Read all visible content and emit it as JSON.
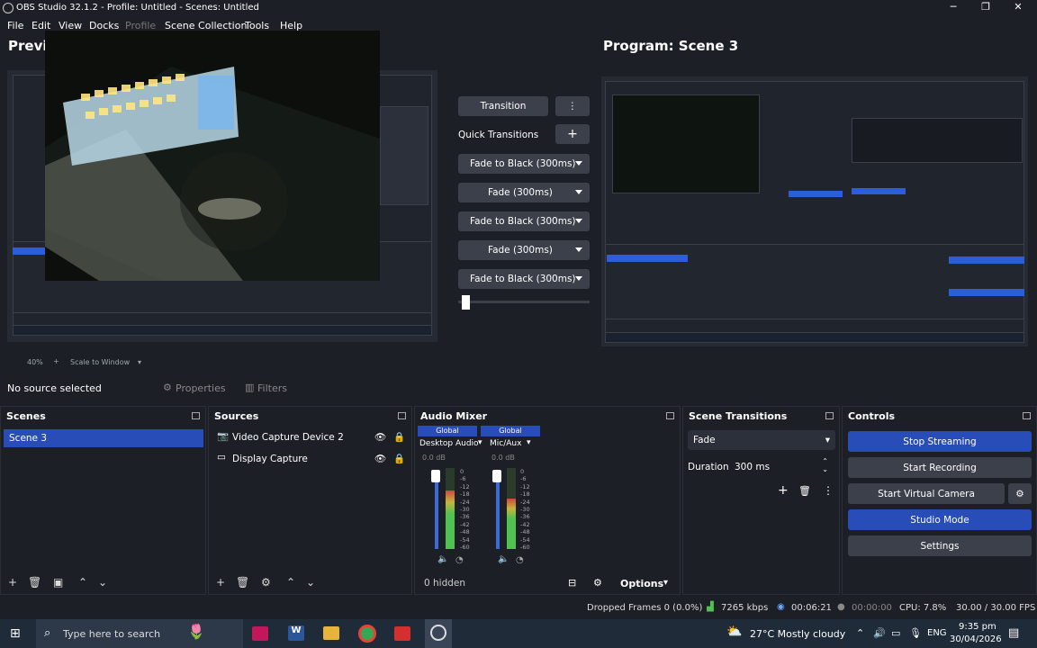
{
  "window": {
    "title": "OBS Studio 32.1.2 - Profile: Untitled - Scenes: Untitled",
    "minimize": "─",
    "maximize": "❐",
    "close": "✕"
  },
  "menu": {
    "items": [
      {
        "label": "File"
      },
      {
        "label": "Edit"
      },
      {
        "label": "View"
      },
      {
        "label": "Docks"
      },
      {
        "label": "Profile"
      },
      {
        "label": "Scene Collection"
      },
      {
        "label": "Tools"
      },
      {
        "label": "Help"
      }
    ]
  },
  "preview": {
    "label": "Previ",
    "zoom": "40%",
    "scale_mode": "Scale to Window"
  },
  "program": {
    "label": "Program: Scene 3"
  },
  "transitions": {
    "transition_label": "Transition",
    "quick_label": "Quick Transitions",
    "buttons": [
      "Fade to Black (300ms)",
      "Fade (300ms)",
      "Fade to Black (300ms)",
      "Fade (300ms)",
      "Fade to Black (300ms)"
    ],
    "tbar_value": 0.03
  },
  "source_bar": {
    "no_source": "No source selected",
    "properties": "Properties",
    "filters": "Filters"
  },
  "scenes": {
    "title": "Scenes",
    "items": [
      "Scene 3"
    ]
  },
  "sources": {
    "title": "Sources",
    "items": [
      {
        "label": "Video Capture Device 2",
        "icon": "camera-icon"
      },
      {
        "label": "Display Capture",
        "icon": "monitor-icon"
      }
    ]
  },
  "audio": {
    "title": "Audio Mixer",
    "channels": [
      {
        "tag": "Global",
        "name": "Desktop Audio",
        "db": "0.0 dB",
        "level": 0.72
      },
      {
        "tag": "Global",
        "name": "Mic/Aux",
        "db": "0.0 dB",
        "level": 0.62
      }
    ],
    "scale": [
      "0",
      "-6",
      "-12",
      "-18",
      "-24",
      "-30",
      "-36",
      "-42",
      "-48",
      "-54",
      "-60"
    ],
    "hidden": "0 hidden",
    "options": "Options"
  },
  "scene_transitions": {
    "title": "Scene Transitions",
    "selected": "Fade",
    "duration_label": "Duration",
    "duration_value": "300 ms"
  },
  "controls": {
    "title": "Controls",
    "stop_streaming": "Stop Streaming",
    "start_recording": "Start Recording",
    "start_virtual_camera": "Start Virtual Camera",
    "studio_mode": "Studio Mode",
    "settings": "Settings"
  },
  "status": {
    "dropped": "Dropped Frames 0 (0.0%)",
    "bitrate": "7265 kbps",
    "stream_time": "00:06:21",
    "rec_time": "00:00:00",
    "cpu": "CPU: 7.8%",
    "fps": "30.00 / 30.00 FPS"
  },
  "taskbar": {
    "search_placeholder": "Type here to search",
    "weather": "27°C  Mostly cloudy",
    "lang": "ENG",
    "time": "9:35 pm",
    "date": "30/04/2026"
  },
  "colors": {
    "accent": "#284cb8",
    "panel": "#1d1f26",
    "button": "#3c404b",
    "meter_green": "#4fc24f",
    "meter_yellow": "#c8b43a",
    "meter_red": "#c84a3a"
  }
}
